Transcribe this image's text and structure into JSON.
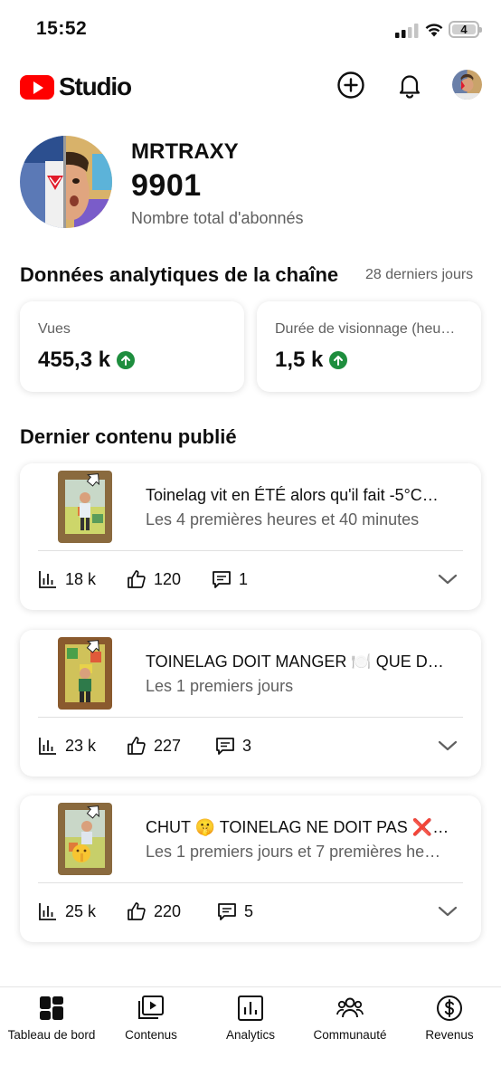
{
  "status_bar": {
    "time": "15:52",
    "battery": "4"
  },
  "header": {
    "brand": "Studio"
  },
  "channel": {
    "name": "MRTRAXY",
    "subscribers": "9901",
    "subscribers_label": "Nombre total d'abonnés"
  },
  "analytics": {
    "title": "Données analytiques de la chaîne",
    "period": "28 derniers jours",
    "cards": [
      {
        "label": "Vues",
        "value": "455,3 k"
      },
      {
        "label": "Durée de visionnage (heu…",
        "value": "1,5 k"
      }
    ]
  },
  "latest": {
    "title": "Dernier contenu publié",
    "videos": [
      {
        "title": "Toinelag vit  en ÉTÉ alors qu'il fait -5°C…",
        "subtitle": "Les 4 premières heures et 40 minutes",
        "views": "18 k",
        "likes": "120",
        "comments": "1"
      },
      {
        "title": "TOINELAG DOIT  MANGER  🍽️ QUE D…",
        "subtitle": "Les 1 premiers jours",
        "views": "23 k",
        "likes": "227",
        "comments": "3"
      },
      {
        "title": "CHUT 🤫 TOINELAG NE DOIT PAS ❌…",
        "subtitle": "Les 1 premiers jours et 7 premières he…",
        "views": "25 k",
        "likes": "220",
        "comments": "5"
      }
    ]
  },
  "bottom_nav": [
    {
      "label": "Tableau de bord",
      "icon": "dashboard-icon"
    },
    {
      "label": "Contenus",
      "icon": "content-icon"
    },
    {
      "label": "Analytics",
      "icon": "analytics-icon"
    },
    {
      "label": "Communauté",
      "icon": "community-icon"
    },
    {
      "label": "Revenus",
      "icon": "revenue-icon"
    }
  ],
  "colors": {
    "brand_red": "#ff0000",
    "trend_up_green": "#1e8e3e",
    "secondary_text": "#606060"
  }
}
